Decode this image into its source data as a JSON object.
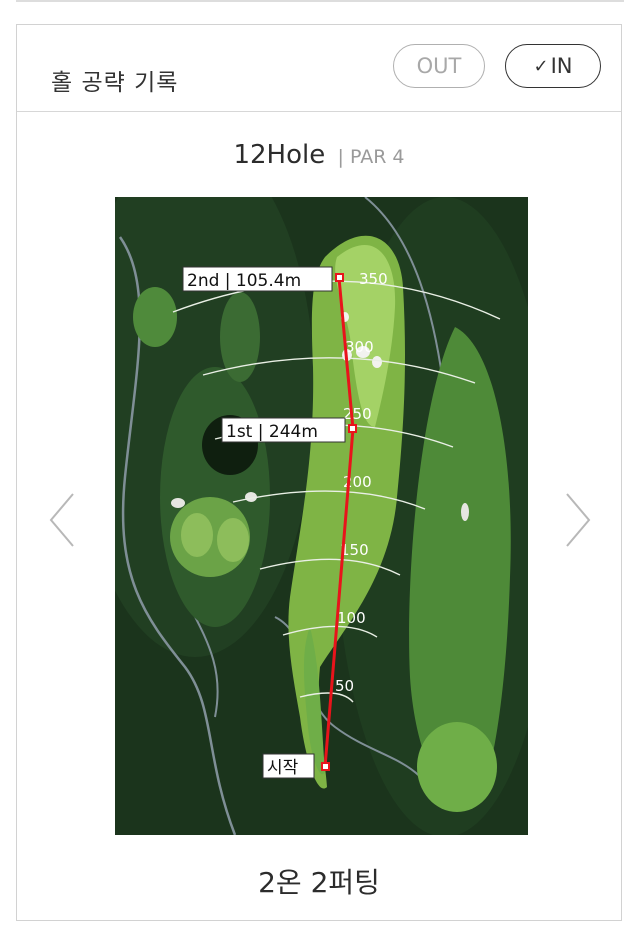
{
  "header": {
    "title": "홀 공략 기록",
    "out_label": "OUT",
    "in_check": "✓",
    "in_label": "IN"
  },
  "hole": {
    "name": "12Hole",
    "separator": "|",
    "par": "PAR 4"
  },
  "map": {
    "distance_marks": [
      "350",
      "300",
      "250",
      "200",
      "150",
      "100",
      "50"
    ],
    "shots": [
      {
        "label": "2nd | 105.4m"
      },
      {
        "label": "1st | 244m"
      },
      {
        "label": "시작"
      }
    ],
    "colors": {
      "shot_line": "#e8141b",
      "rough": "#1d3a1e",
      "fairway": "#8ec24f",
      "green": "#a4d266"
    }
  },
  "result": {
    "text": "2온 2퍼팅"
  },
  "icons": {
    "prev": "chevron-left-icon",
    "next": "chevron-right-icon"
  }
}
